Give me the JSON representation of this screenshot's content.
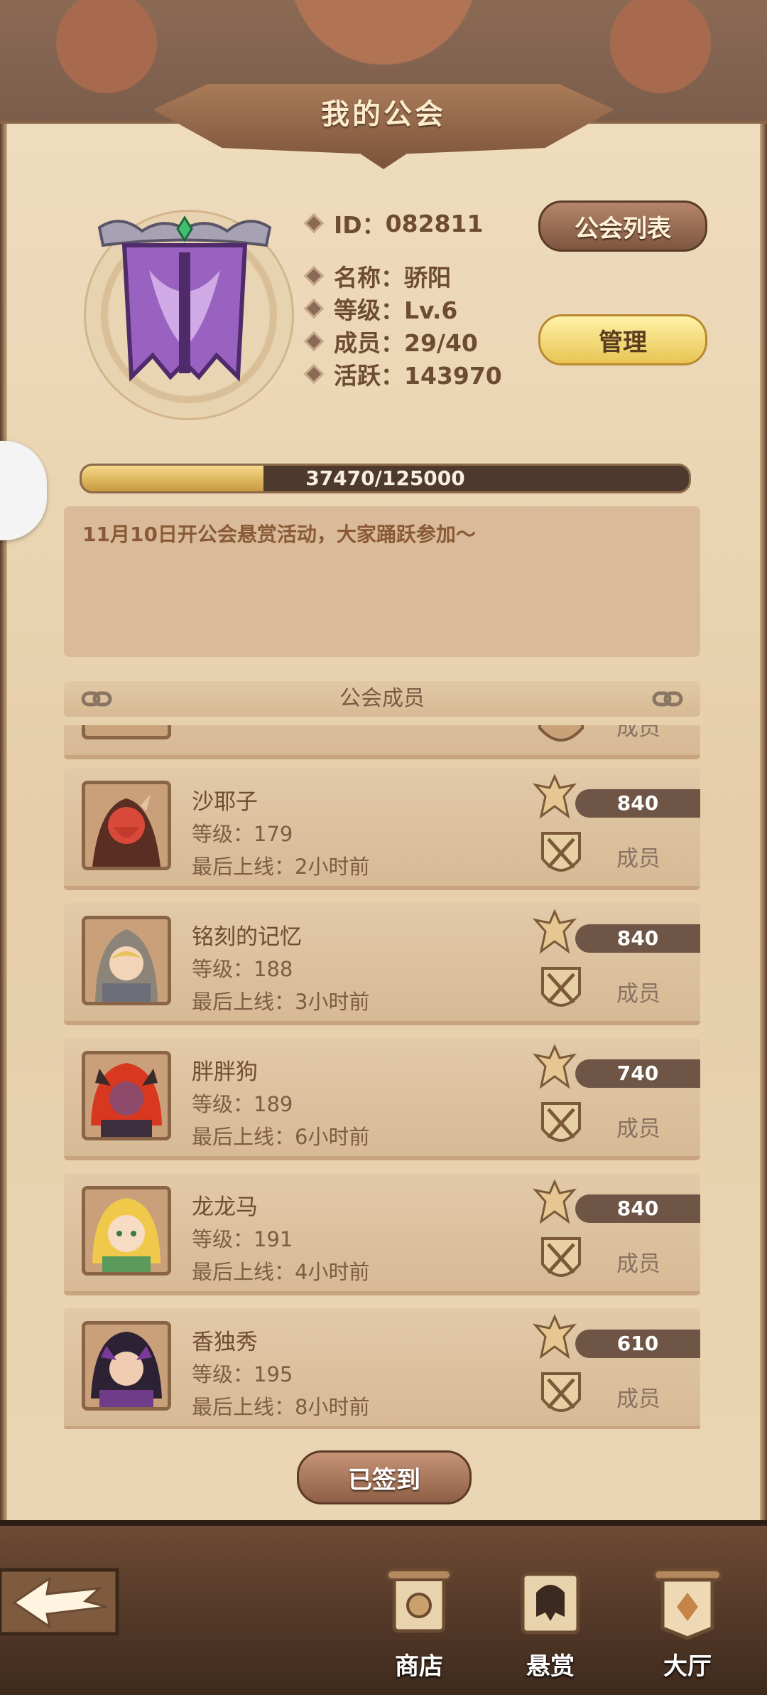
{
  "header": {
    "title": "我的公会"
  },
  "guild": {
    "id_label": "ID：",
    "id_value": "082811",
    "name_line": "名称：骄阳",
    "level_line": "等级：Lv.6",
    "members_line": "成员：29/40",
    "activity_line": "活跃：143970"
  },
  "buttons": {
    "guild_list": "公会列表",
    "manage": "管理",
    "signed_in": "已签到"
  },
  "progress": {
    "text": "37470/125000",
    "current": 37470,
    "max": 125000
  },
  "notice": {
    "text": "11月10日开公会悬赏活动，大家踊跃参加～"
  },
  "members_section": {
    "title": "公会成员",
    "members": [
      {
        "name": "沙耶子",
        "level": "等级：179",
        "last_online": "最后上线：2小时前",
        "points": "840",
        "role": "成员"
      },
      {
        "name": "铭刻的记忆",
        "level": "等级：188",
        "last_online": "最后上线：3小时前",
        "points": "840",
        "role": "成员"
      },
      {
        "name": "胖胖狗",
        "level": "等级：189",
        "last_online": "最后上线：6小时前",
        "points": "740",
        "role": "成员"
      },
      {
        "name": "龙龙马",
        "level": "等级：191",
        "last_online": "最后上线：4小时前",
        "points": "840",
        "role": "成员"
      },
      {
        "name": "香独秀",
        "level": "等级：195",
        "last_online": "最后上线：8小时前",
        "points": "610",
        "role": "成员"
      }
    ],
    "partial_top_role": "成员"
  },
  "bottom_nav": {
    "shop": "商店",
    "bounty": "悬赏",
    "hall": "大厅"
  },
  "colors": {
    "panel": "#e8d3b0",
    "accent_gold": "#e8c452",
    "brown": "#7e5640"
  }
}
